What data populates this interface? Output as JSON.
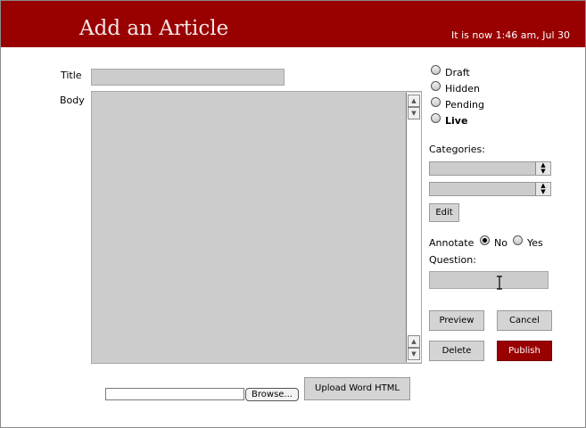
{
  "header": {
    "title": "Add an Article",
    "clock": "It is now 1:46 am, Jul 30",
    "color": "#990000"
  },
  "form": {
    "title_label": "Title",
    "title_value": "",
    "body_label": "Body",
    "body_value": ""
  },
  "status": {
    "options": [
      "Draft",
      "Hidden",
      "Pending",
      "Live"
    ],
    "selected": ""
  },
  "categories": {
    "label": "Categories:",
    "select_1_value": "",
    "select_2_value": "",
    "edit_label": "Edit"
  },
  "annotate": {
    "label": "Annotate",
    "no_label": "No",
    "yes_label": "Yes",
    "selected": "No",
    "question_label": "Question:",
    "question_value": ""
  },
  "actions": {
    "preview": "Preview",
    "cancel": "Cancel",
    "delete": "Delete",
    "publish": "Publish"
  },
  "upload": {
    "file_value": "",
    "browse_label": "Browse...",
    "upload_label": "Upload Word HTML"
  }
}
